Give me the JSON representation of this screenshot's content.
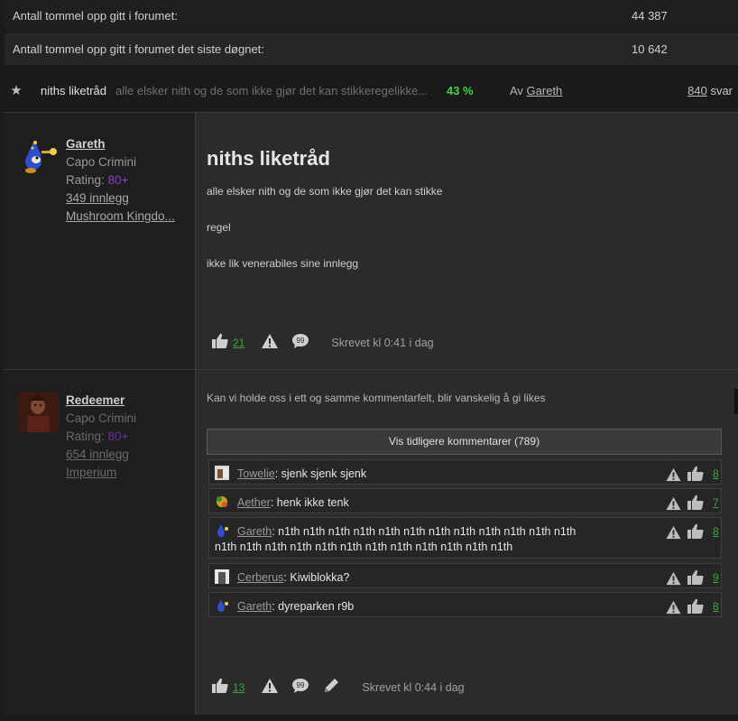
{
  "stats": [
    {
      "label": "Antall tommel opp gitt i forumet:",
      "value": "44 387"
    },
    {
      "label": "Antall tommel opp gitt i forumet det siste døgnet:",
      "value": "10 642"
    }
  ],
  "thread": {
    "name": "niths liketråd",
    "snippet": "alle elsker nith og de som ikke gjør det kan stikkeregelikke...",
    "percent": "43 %",
    "by_prefix": "Av",
    "author": "Gareth",
    "replies_count": "840",
    "replies_label": "svar"
  },
  "posts": [
    {
      "username": "Gareth",
      "title": "Capo Crimini",
      "rating_label": "Rating:",
      "rating_value": "80+",
      "posts_link": "349 innlegg",
      "location": "Mushroom Kingdo...",
      "heading": "niths liketråd",
      "paragraphs": [
        "alle elsker nith og de som ikke gjør det kan stikke",
        "regel",
        "ikke lik venerabiles sine innlegg"
      ],
      "likes": "21",
      "written": "Skrevet kl 0:41 i dag"
    },
    {
      "username": "Redeemer",
      "title": "Capo Crimini",
      "rating_label": "Rating:",
      "rating_value": "80+",
      "posts_link": "654 innlegg",
      "location": "Imperium",
      "paragraphs": [
        "Kan vi holde oss i ett og samme kommentarfelt, blir vanskelig å gi likes"
      ],
      "show_earlier": "Vis tidligere kommentarer (789)",
      "comments": [
        {
          "user": "Towelie",
          "text": ": sjenk sjenk sjenk",
          "count": "8"
        },
        {
          "user": "Aether",
          "text": ": henk ikke tenk",
          "count": "7"
        },
        {
          "user": "Gareth",
          "text": ": n1th n1th n1th n1th n1th n1th n1th n1th n1th n1th n1th n1th",
          "text2": "n1th n1th n1th n1th n1th n1th n1th n1th n1th n1th n1th n1th",
          "count": "8"
        },
        {
          "user": "Cerberus",
          "text": ": Kiwiblokka?",
          "count": "9"
        },
        {
          "user": "Gareth",
          "text": ": dyreparken r9b",
          "count": "8"
        }
      ],
      "likes": "13",
      "written": "Skrevet kl 0:44 i dag"
    }
  ],
  "colors": {
    "accent_green": "#3bd63b",
    "rating_purple": "#8a3fc6",
    "like_green": "#3aa63a"
  },
  "icons": [
    "star-icon",
    "thumbs-up-icon",
    "warning-icon",
    "comment-icon",
    "pencil-icon"
  ]
}
